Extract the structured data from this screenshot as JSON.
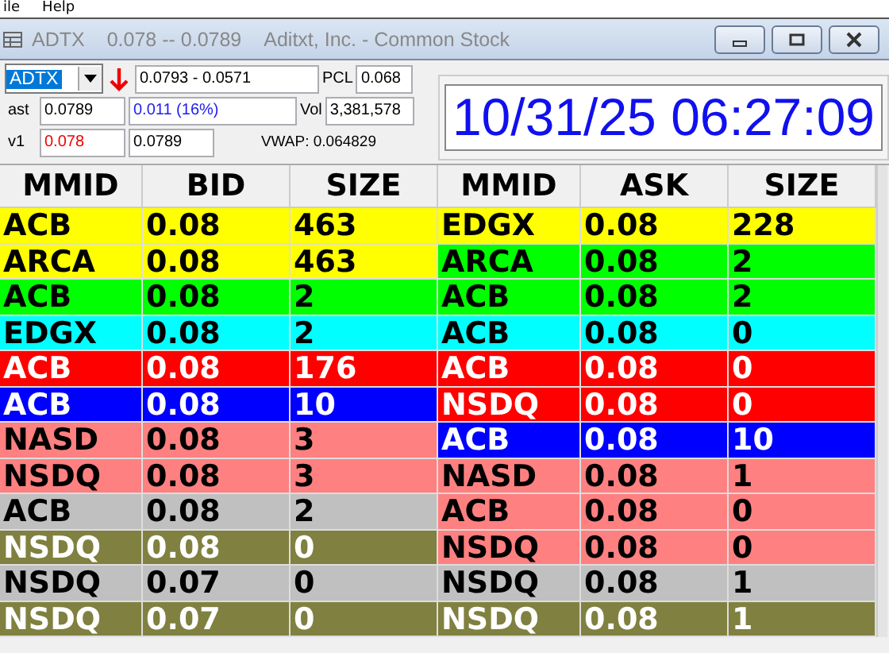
{
  "menu": [
    "ile",
    "Help"
  ],
  "window": {
    "title_symbol": "ADTX",
    "title_range": "0.078 -- 0.0789",
    "title_name": "Aditxt, Inc. - Common Stock"
  },
  "quote": {
    "symbol": "ADTX",
    "range": "0.0793 - 0.0571",
    "pcl_label": "PCL",
    "pcl": "0.068",
    "last_label": "ast",
    "last": "0.0789",
    "change": "0.011   (16%)",
    "vol_label": "Vol",
    "vol": "3,381,578",
    "lv1_label": "v1",
    "bid": "0.078",
    "ask": "0.0789",
    "vwap": "VWAP: 0.064829"
  },
  "clock": "10/31/25 06:27:09",
  "bid_columns": [
    "MMID",
    "BID",
    "SIZE"
  ],
  "ask_columns": [
    "MMID",
    "ASK",
    "SIZE"
  ],
  "rows": [
    {
      "bid": {
        "mmid": "ACB",
        "price": "0.08",
        "size": "463",
        "color": "#ffff00"
      },
      "ask": {
        "mmid": "EDGX",
        "price": "0.08",
        "size": "228",
        "color": "#ffff00"
      }
    },
    {
      "bid": {
        "mmid": "ARCA",
        "price": "0.08",
        "size": "463",
        "color": "#ffff00"
      },
      "ask": {
        "mmid": "ARCA",
        "price": "0.08",
        "size": "2",
        "color": "#00ff00"
      }
    },
    {
      "bid": {
        "mmid": "ACB",
        "price": "0.08",
        "size": "2",
        "color": "#00ff00"
      },
      "ask": {
        "mmid": "ACB",
        "price": "0.08",
        "size": "2",
        "color": "#00ff00"
      }
    },
    {
      "bid": {
        "mmid": "EDGX",
        "price": "0.08",
        "size": "2",
        "color": "#00ffff"
      },
      "ask": {
        "mmid": "ACB",
        "price": "0.08",
        "size": "0",
        "color": "#00ffff"
      }
    },
    {
      "bid": {
        "mmid": "ACB",
        "price": "0.08",
        "size": "176",
        "color": "#ff0000"
      },
      "ask": {
        "mmid": "ACB",
        "price": "0.08",
        "size": "0",
        "color": "#ff0000"
      }
    },
    {
      "bid": {
        "mmid": "ACB",
        "price": "0.08",
        "size": "10",
        "color": "#0000ff"
      },
      "ask": {
        "mmid": "NSDQ",
        "price": "0.08",
        "size": "0",
        "color": "#ff0000"
      }
    },
    {
      "bid": {
        "mmid": "NASD",
        "price": "0.08",
        "size": "3",
        "color": "#ff8080"
      },
      "ask": {
        "mmid": "ACB",
        "price": "0.08",
        "size": "10",
        "color": "#0000ff"
      }
    },
    {
      "bid": {
        "mmid": "NSDQ",
        "price": "0.08",
        "size": "3",
        "color": "#ff8080"
      },
      "ask": {
        "mmid": "NASD",
        "price": "0.08",
        "size": "1",
        "color": "#ff8080"
      }
    },
    {
      "bid": {
        "mmid": "ACB",
        "price": "0.08",
        "size": "2",
        "color": "#c0c0c0"
      },
      "ask": {
        "mmid": "ACB",
        "price": "0.08",
        "size": "0",
        "color": "#ff8080"
      }
    },
    {
      "bid": {
        "mmid": "NSDQ",
        "price": "0.08",
        "size": "0",
        "color": "#808040"
      },
      "ask": {
        "mmid": "NSDQ",
        "price": "0.08",
        "size": "0",
        "color": "#ff8080"
      }
    },
    {
      "bid": {
        "mmid": "NSDQ",
        "price": "0.07",
        "size": "0",
        "color": "#c0c0c0"
      },
      "ask": {
        "mmid": "NSDQ",
        "price": "0.08",
        "size": "1",
        "color": "#c0c0c0"
      }
    },
    {
      "bid": {
        "mmid": "NSDQ",
        "price": "0.07",
        "size": "0",
        "color": "#808040"
      },
      "ask": {
        "mmid": "NSDQ",
        "price": "0.08",
        "size": "1",
        "color": "#808040"
      }
    }
  ]
}
